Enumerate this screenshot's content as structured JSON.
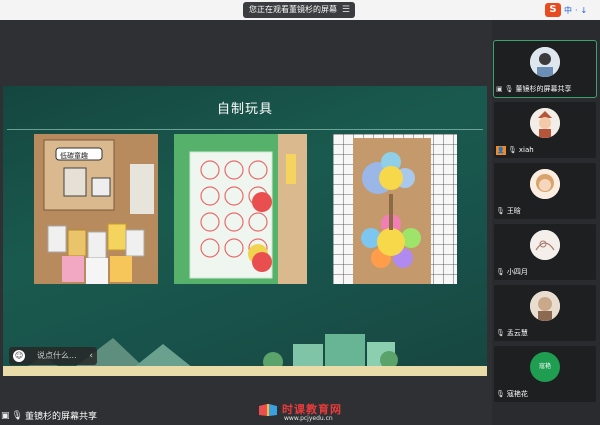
{
  "topbar": {
    "viewing_text": "您正在观看董镜杉的屏幕",
    "menu_icon": "menu-icon",
    "ime_chars": [
      "中",
      "·",
      "↓"
    ]
  },
  "slide": {
    "title": "自制玩具",
    "photos": [
      {
        "name": "handmade-toys-photo-1",
        "caption": "低碳童趣"
      },
      {
        "name": "handmade-toys-photo-2"
      },
      {
        "name": "handmade-toys-photo-3"
      }
    ]
  },
  "chat": {
    "placeholder": "说点什么...",
    "collapse_glyph": "‹"
  },
  "share_label": "董镜杉的屏幕共享",
  "watermark": {
    "title": "时课教育网",
    "url": "www.pcjyedu.cn"
  },
  "participants": [
    {
      "name": "董镜杉的屏幕共享",
      "screen_share": true,
      "active": true,
      "avatar_color": "#6b8fb4"
    },
    {
      "name": "xiah",
      "badge": "host",
      "avatar_color": "#b5553a"
    },
    {
      "name": "王晗",
      "avatar_color": "#d9a46b"
    },
    {
      "name": "小四月",
      "avatar_color": "#e9dcd3"
    },
    {
      "name": "孟云慧",
      "avatar_color": "#caa98a"
    },
    {
      "name": "寇艳花",
      "avatar_color": "#1f9e52",
      "avatar_text": "寇艳"
    }
  ],
  "colors": {
    "accent_green": "#3ca370",
    "watermark_red": "#e83b3b"
  }
}
